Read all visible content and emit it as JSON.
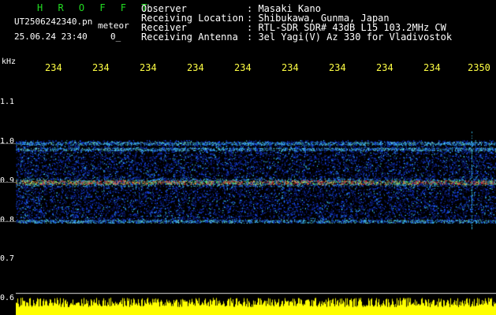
{
  "header": {
    "brand": "H R O F F T",
    "filename": "UT2506242340.pn",
    "filename_suffix": "meteor",
    "datetime": "25.06.24 23:40",
    "count": "0_",
    "fields": [
      {
        "label": "Observer",
        "value": ": Masaki Kano"
      },
      {
        "label": "Receiving Location",
        "value": ": Shibukawa, Gunma, Japan"
      },
      {
        "label": "Receiver",
        "value": ": RTL-SDR SDR# 43dB L15 103.2MHz CW"
      },
      {
        "label": "Receiving Antenna",
        "value": ": 3el Yagi(V) Az 330 for Vladivostok"
      }
    ]
  },
  "axes": {
    "y_unit": "kHz",
    "y_ticks": [
      "1.1",
      "1.0",
      "0.9",
      "0.8",
      "0.7",
      "0.6"
    ],
    "x_ticks": [
      "234",
      "234",
      "234",
      "234",
      "234",
      "234",
      "234",
      "234",
      "234",
      "2350"
    ]
  },
  "colors": {
    "background": "#000000",
    "tick_text": "#ffff44",
    "brand": "#22dd22",
    "noise_low": "#0c1a7a",
    "noise_mid": "#1a4cff",
    "noise_high": "#3fd0ff",
    "signal": "#ff3030",
    "meter": "#ffff00"
  },
  "spectrogram": {
    "freq_range": [
      0.6,
      1.14
    ],
    "band_range": [
      0.796,
      1.008
    ],
    "bright_lines": [
      1.0,
      0.9,
      0.8,
      0.985
    ],
    "signal_freq": 0.9
  }
}
